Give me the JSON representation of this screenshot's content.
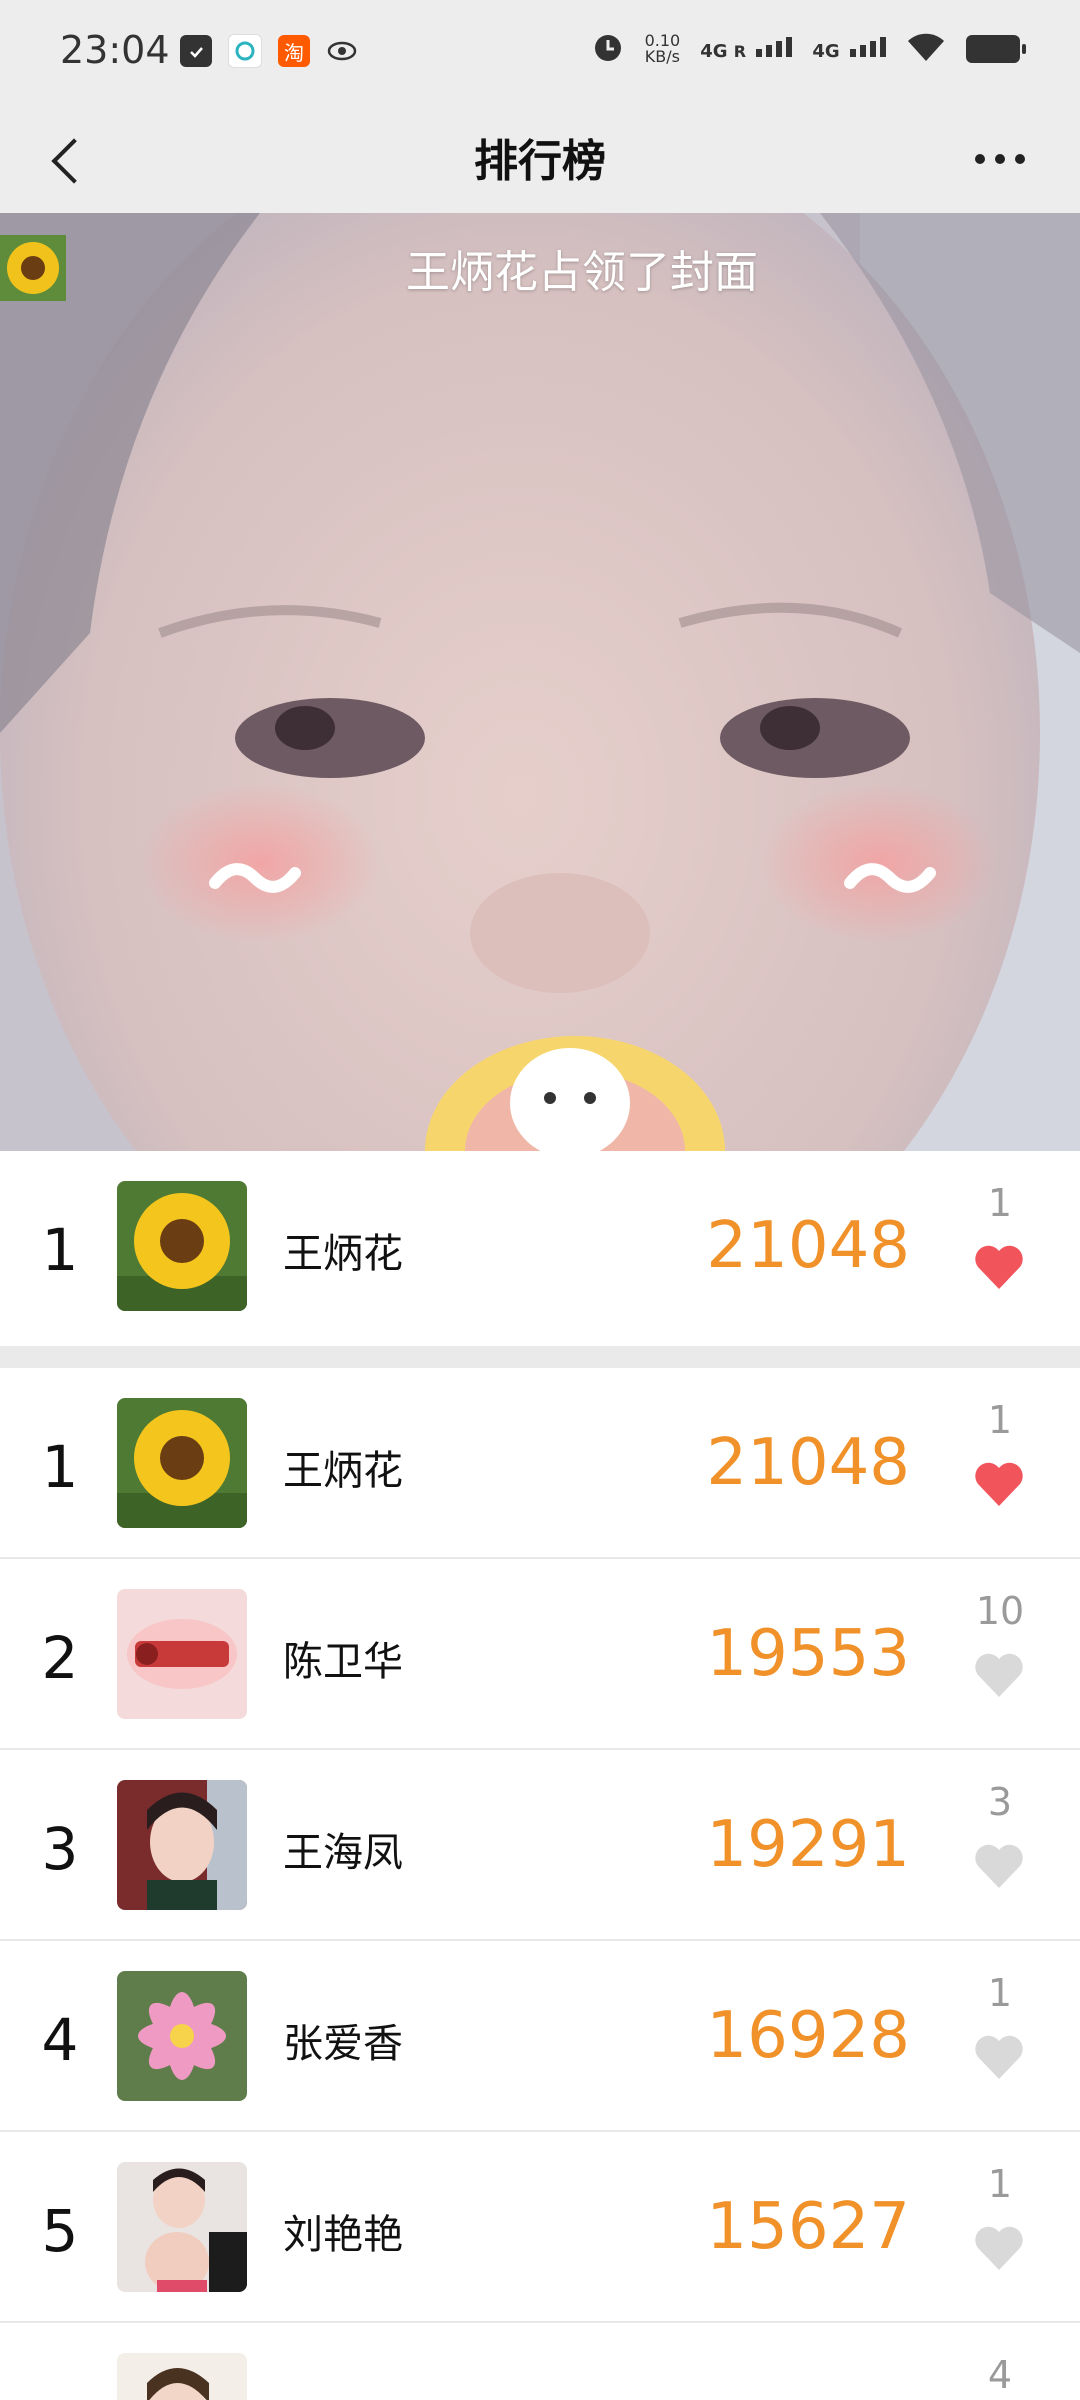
{
  "status_bar": {
    "time": "23:04",
    "speed_value": "0.10",
    "speed_unit": "KB/s",
    "net1": "4G",
    "net1_sub": "R",
    "net2": "4G",
    "icons": [
      "clipboard-icon",
      "wallet-app-icon",
      "taobao-icon",
      "visibility-icon",
      "alarm-icon",
      "signal-icon",
      "wifi-icon",
      "battery-icon"
    ],
    "taobao_glyph": "淘"
  },
  "nav": {
    "title": "排行榜"
  },
  "cover": {
    "banner_text": "王炳花占领了封面"
  },
  "top_row": {
    "rank": "1",
    "name": "王炳花",
    "score": "21048",
    "likes": "1",
    "liked": true
  },
  "ranking": [
    {
      "rank": "1",
      "name": "王炳花",
      "score": "21048",
      "likes": "1",
      "liked": true
    },
    {
      "rank": "2",
      "name": "陈卫华",
      "score": "19553",
      "likes": "10",
      "liked": false
    },
    {
      "rank": "3",
      "name": "王海凤",
      "score": "19291",
      "likes": "3",
      "liked": false
    },
    {
      "rank": "4",
      "name": "张爱香",
      "score": "16928",
      "likes": "1",
      "liked": false
    },
    {
      "rank": "5",
      "name": "刘艳艳",
      "score": "15627",
      "likes": "1",
      "liked": false
    },
    {
      "rank": "",
      "name": "",
      "score": "",
      "likes": "4",
      "liked": false
    }
  ],
  "colors": {
    "score": "#f0912a",
    "heart_active": "#f2545b",
    "heart_inactive": "#d9d9d9"
  }
}
